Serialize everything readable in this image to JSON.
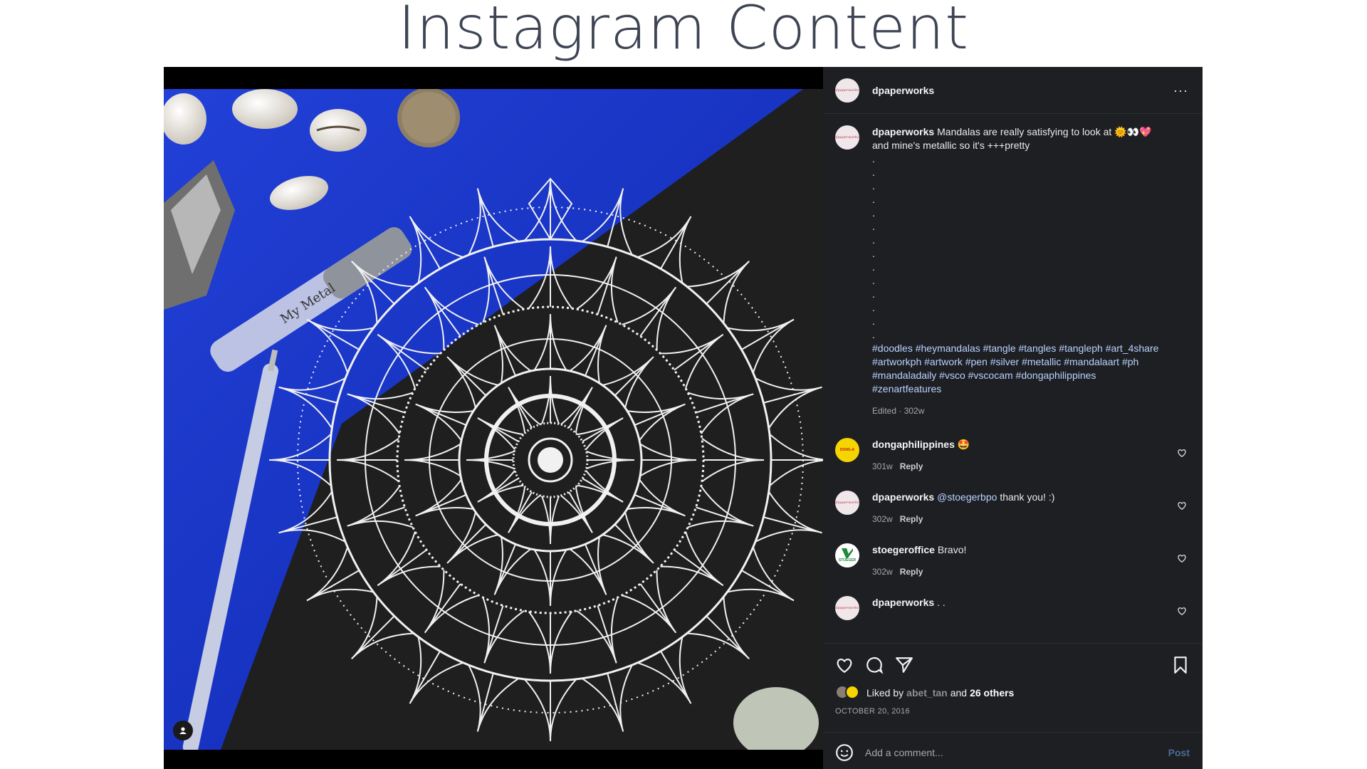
{
  "slide": {
    "title": "Instagram Content"
  },
  "post": {
    "author": "dpaperworks",
    "more_label": "···",
    "photo_alt": "",
    "caption": {
      "username": "dpaperworks",
      "text": "Mandalas are really satisfying to look at 🌞👀💖 and mine's metallic so it's +++pretty",
      "dots": ".\n.\n.\n.\n.\n.\n.\n.\n.\n.\n.\n.\n.\n.",
      "hashtags": "#doodles #heymandalas #tangle #tangles #tangleph #art_4share #artworkph #artwork #pen #silver #metallic #mandalaart #ph #mandaladaily #vsco #vscocam #dongaphilippines #zenartfeatures",
      "meta": "Edited · 302w"
    },
    "comments": [
      {
        "username": "dongaphilippines",
        "text": "🤩",
        "mention": "",
        "time": "301w",
        "reply": "Reply",
        "avatar": "donga",
        "avatar_text": "DONG-A"
      },
      {
        "username": "dpaperworks",
        "mention": "@stoegerbpo",
        "text": "thank you! :)",
        "time": "302w",
        "reply": "Reply",
        "avatar": "dpaperworks",
        "avatar_text": "dpaperworks"
      },
      {
        "username": "stoegeroffice",
        "mention": "",
        "text": "Bravo!",
        "time": "302w",
        "reply": "Reply",
        "avatar": "stoeger",
        "avatar_text": "STOEGER"
      },
      {
        "username": "dpaperworks",
        "mention": "",
        "text": ". .",
        "time": "",
        "reply": "",
        "avatar": "dpaperworks",
        "avatar_text": "dpaperworks"
      }
    ],
    "likes": {
      "prefix": "Liked by",
      "user": "abet_tan",
      "conj": "and",
      "others": "26 others"
    },
    "date": "OCTOBER 20, 2016",
    "add_comment": {
      "placeholder": "Add a comment...",
      "post_label": "Post"
    },
    "icons": {
      "like": "heart-icon",
      "comment": "comment-icon",
      "share": "send-icon",
      "save": "bookmark-icon",
      "emoji": "emoji-icon",
      "more": "more-icon",
      "tag": "user-tag-icon"
    },
    "colors": {
      "panel_bg": "#1e1f23",
      "hashtag": "#b9d2ff",
      "backdrop_blue": "#1431c9",
      "paper_black": "#1c1c1c"
    }
  }
}
